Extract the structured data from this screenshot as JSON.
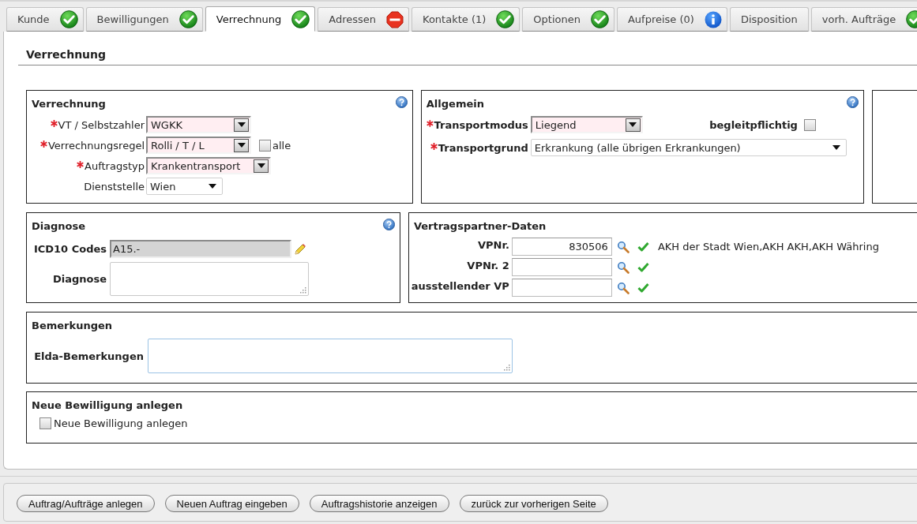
{
  "tabs": [
    {
      "label": "Kunde",
      "kind": "ok",
      "selected": false
    },
    {
      "label": "Bewilligungen",
      "kind": "ok",
      "selected": false
    },
    {
      "label": "Verrechnung",
      "kind": "ok",
      "selected": true
    },
    {
      "label": "Adressen",
      "kind": "stop",
      "selected": false
    },
    {
      "label": "Kontakte (1)",
      "kind": "ok",
      "selected": false
    },
    {
      "label": "Optionen",
      "kind": "ok",
      "selected": false
    },
    {
      "label": "Aufpreise (0)",
      "kind": "info",
      "selected": false
    },
    {
      "label": "Disposition",
      "kind": "plain",
      "selected": false
    },
    {
      "label": "vorh. Aufträge",
      "kind": "ok",
      "selected": false
    }
  ],
  "page_title": "Verrechnung",
  "verrechnung": {
    "title": "Verrechnung",
    "fields": [
      {
        "label": "VT / Selbstzahler",
        "required": true,
        "kind": "select",
        "value": "WGKK"
      },
      {
        "label": "Verrechnungsregel",
        "required": true,
        "kind": "select",
        "value": "Rolli / T / L",
        "checkbox": {
          "label": "alle",
          "checked": false
        }
      },
      {
        "label": "Auftragstyp",
        "required": true,
        "kind": "select",
        "value": "Krankentransport"
      },
      {
        "label": "Dienststelle",
        "required": false,
        "kind": "dropdown",
        "value": "Wien"
      }
    ]
  },
  "allgemein": {
    "title": "Allgemein",
    "fields": [
      {
        "label": "Transportmodus",
        "required": true,
        "kind": "select",
        "value": "Liegend",
        "checkbox": {
          "label": "begleitpflichtig",
          "checked": false
        }
      },
      {
        "label": "Transportgrund",
        "required": true,
        "kind": "dropdown",
        "value": "Erkrankung (alle übrigen Erkrankungen)"
      }
    ]
  },
  "diagnose": {
    "title": "Diagnose",
    "icd10": {
      "label": "ICD10 Codes",
      "value": "A15.-"
    },
    "text": {
      "label": "Diagnose"
    }
  },
  "vertragspartner": {
    "title": "Vertragspartner-Daten",
    "rows": [
      {
        "label": "VPNr.",
        "value": "830506",
        "name": "AKH der Stadt Wien,AKH AKH,AKH Währing"
      },
      {
        "label": "VPNr. 2"
      },
      {
        "label": "ausstellender VP"
      }
    ]
  },
  "bemerkungen": {
    "title": "Bemerkungen",
    "label": "Elda-Bemerkungen"
  },
  "neue_bewilligung": {
    "title": "Neue Bewilligung anlegen",
    "checkbox": {
      "label": "Neue Bewilligung anlegen",
      "checked": false
    }
  },
  "buttons": [
    "Auftrag/Aufträge anlegen",
    "Neuen Auftrag eingeben",
    "Auftragshistorie anzeigen",
    "zurück zur vorherigen Seite"
  ]
}
